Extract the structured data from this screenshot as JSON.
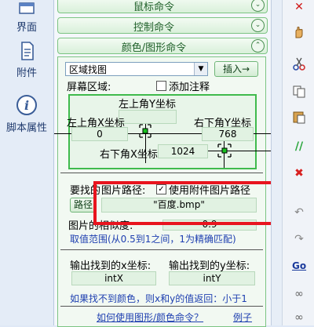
{
  "sidebar": {
    "items": [
      {
        "label": "界面",
        "icon": "window-icon"
      },
      {
        "label": "附件",
        "icon": "document-icon"
      },
      {
        "label": "脚本属性",
        "icon": "info-icon"
      }
    ]
  },
  "categories": {
    "mouse": "鼠标命令",
    "control": "控制命令",
    "color_graphics": "颜色/图形命令"
  },
  "command": {
    "selected": "区域找图",
    "insert_label": "插入→"
  },
  "screen_region": {
    "label": "屏幕区域:",
    "add_comment_label": "添加注释",
    "add_comment_checked": false,
    "top_left_x_label": "左上角X坐标",
    "top_left_x_value": "",
    "top_left_y_label": "左上角Y坐标",
    "top_left_y_value": "0",
    "bottom_right_y_label": "右下角Y坐标",
    "bottom_right_y_value": "768",
    "bottom_right_x_label": "右下角X坐标",
    "bottom_right_x_value": "1024"
  },
  "image": {
    "find_label_prefix": "要找的",
    "path_label": "图片路径:",
    "use_attachment_label": "使用附件图片路径",
    "use_attachment_checked": true,
    "path_button_label": "路径",
    "path_value": "\"百度.bmp\"",
    "similarity_label": "图片的相似度:",
    "similarity_value": "0.9",
    "range_note": "取值范围(从0.5到1之间，1为精确匹配)"
  },
  "output": {
    "x_label": "输出找到的x坐标:",
    "x_value": "intX",
    "y_label": "输出找到的y坐标:",
    "y_value": "intY",
    "not_found_note": "如果找不到颜色，则x和y的值返回：小于1"
  },
  "links": {
    "help": "如何使用图形/颜色命令？",
    "example": "例子"
  },
  "toolbar": {
    "tools": [
      "close-red-icon",
      "hand-icon",
      "scissors-icon",
      "copy-icon",
      "paste-icon",
      "green-marker-icon",
      "red-x-icon",
      "undo-icon",
      "redo-icon",
      "go-icon",
      "binoculars-icon",
      "binoculars-next-icon"
    ],
    "go_label": "Go"
  },
  "colors": {
    "accent_green": "#7cc483",
    "highlight_red": "#e8141e",
    "link_blue": "#1e3fb0"
  }
}
